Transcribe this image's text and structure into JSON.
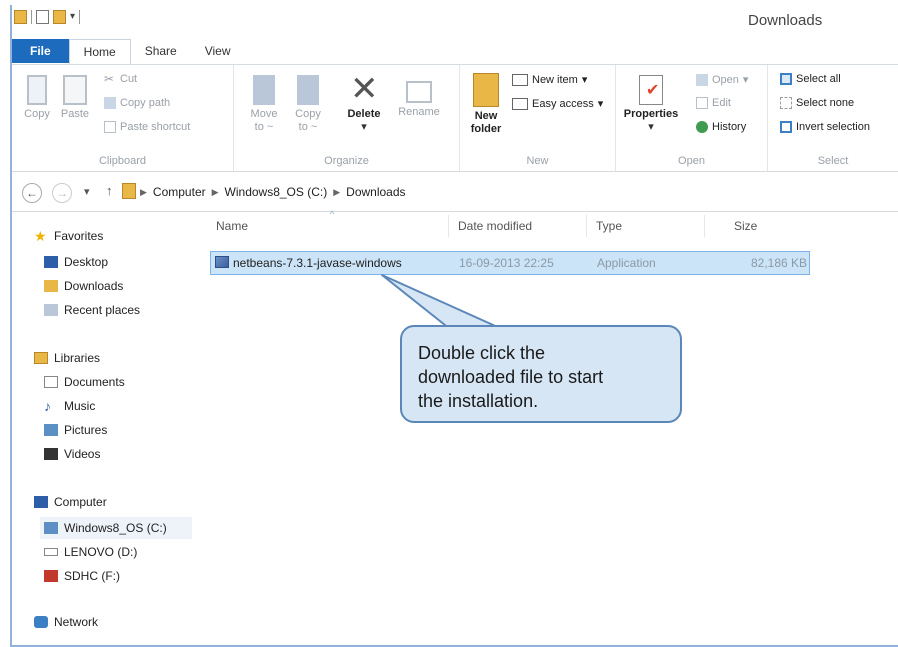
{
  "window": {
    "title": "Downloads"
  },
  "tabs": [
    "File",
    "Home",
    "Share",
    "View"
  ],
  "ribbon": {
    "clipboard": {
      "copy": "Copy",
      "paste": "Paste",
      "cut": "Cut",
      "copy_path": "Copy path",
      "paste_shortcut": "Paste shortcut",
      "label": "Clipboard"
    },
    "organize": {
      "move_to": "Move",
      "move_to_2": "to ~",
      "copy_to": "Copy",
      "copy_to_2": "to ~",
      "delete": "Delete",
      "rename": "Rename",
      "label": "Organize"
    },
    "new": {
      "new_folder": "New",
      "new_folder_2": "folder",
      "new_item": "New item",
      "easy_access": "Easy access",
      "label": "New"
    },
    "open": {
      "properties": "Properties",
      "open": "Open",
      "edit": "Edit",
      "history": "History",
      "label": "Open"
    },
    "select": {
      "select_all": "Select all",
      "select_none": "Select none",
      "invert": "Invert selection",
      "label": "Select"
    }
  },
  "address": {
    "crumbs": [
      "Computer",
      "Windows8_OS (C:)",
      "Downloads"
    ]
  },
  "nav": {
    "favorites": "Favorites",
    "desktop": "Desktop",
    "downloads": "Downloads",
    "recent": "Recent places",
    "libraries": "Libraries",
    "documents": "Documents",
    "music": "Music",
    "pictures": "Pictures",
    "videos": "Videos",
    "computer": "Computer",
    "drive_c": "Windows8_OS (C:)",
    "drive_d": "LENOVO (D:)",
    "drive_f": "SDHC (F:)",
    "network": "Network"
  },
  "columns": {
    "name": "Name",
    "date": "Date modified",
    "type": "Type",
    "size": "Size"
  },
  "files": [
    {
      "name": "netbeans-7.3.1-javase-windows",
      "date": "16-09-2013 22:25",
      "type": "Application",
      "size": "82,186 KB"
    }
  ],
  "callout": {
    "line1": "Double click the",
    "line2": "downloaded file to start",
    "line3": "the installation."
  },
  "colors": {
    "file_tab": "#1c6bbd",
    "selection": "#cce4f7",
    "callout_bg": "#d6e6f5",
    "callout_border": "#5b87b8"
  }
}
